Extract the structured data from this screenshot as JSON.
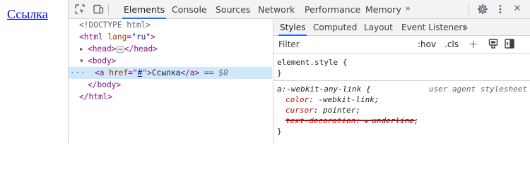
{
  "page": {
    "link_text": "Ссылка"
  },
  "toolbar": {
    "inspect_icon": "inspect-icon",
    "device_icon": "device-toolbar-icon",
    "tabs": [
      "Elements",
      "Console",
      "Sources",
      "Network",
      "Performance",
      "Memory"
    ],
    "active_tab": "Elements",
    "more": "»",
    "settings_icon": "gear-icon",
    "menu_icon": "kebab-menu-icon",
    "close": "✕"
  },
  "tree": {
    "doctype": "<!DOCTYPE html>",
    "html_open_tag": "<html",
    "html_attr": "lang",
    "html_attr_val": "\"ru\"",
    "head_open": "<head>",
    "head_close": "</head>",
    "ellipsis": "…",
    "body_open": "<body>",
    "a_open": "<a",
    "a_attr": "href",
    "a_attr_val": "#",
    "a_text": "Ссылка",
    "a_close": "</a>",
    "selected_marker": "== $0",
    "gutter": "···",
    "body_close": "</body>",
    "html_close": "</html>"
  },
  "styles": {
    "subtabs": [
      "Styles",
      "Computed",
      "Layout",
      "Event Listeners"
    ],
    "active_subtab": "Styles",
    "more": "»",
    "filter_placeholder": "Filter",
    "hov": ":hov",
    "cls": ".cls",
    "plus": "+",
    "rules": [
      {
        "selector": "element.style {",
        "close": "}"
      },
      {
        "selector": "a:-webkit-any-link {",
        "source": "user agent stylesheet",
        "props": [
          {
            "name": "color",
            "value": "-webkit-link;"
          },
          {
            "name": "cursor",
            "value": "pointer;"
          },
          {
            "name": "text-decoration",
            "value": "underline;"
          }
        ],
        "close": "}"
      }
    ]
  },
  "colors": {
    "accent": "#1a73e8",
    "selected_row": "#cfe8fc",
    "annotation": "#d50000"
  }
}
